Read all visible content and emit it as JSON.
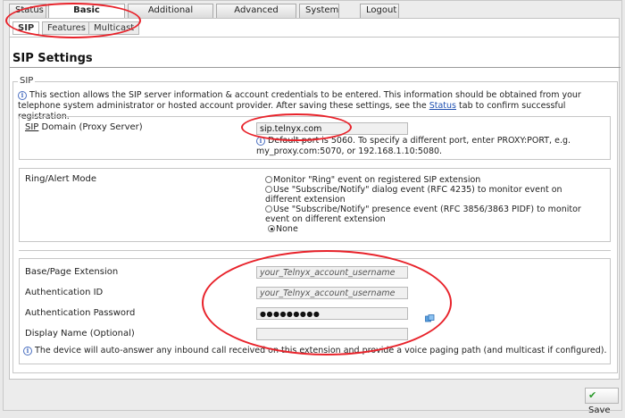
{
  "top_tabs": [
    "Status",
    "Basic Settings",
    "Additional Features",
    "Advanced Settings",
    "System",
    "Logout"
  ],
  "sub_tabs": [
    "SIP",
    "Features",
    "Multicast"
  ],
  "page_title": "SIP Settings",
  "legend": "SIP",
  "intro": {
    "text_before_link": "This section allows the SIP server information & account credentials to be entered. This information should be obtained from your telephone system administrator or hosted account provider. After saving these settings, see the ",
    "link": "Status",
    "text_after_link": " tab to confirm successful registration."
  },
  "sip_domain": {
    "label_abbr": "SIP",
    "label_rest": " Domain (Proxy Server)",
    "value": "sip.telnyx.com",
    "hint": "Default port is 5060. To specify a different port, enter PROXY:PORT, e.g. my_proxy.com:5070, or 192.168.1.10:5080."
  },
  "ring_mode": {
    "label": "Ring/Alert Mode",
    "options": [
      "Monitor \"Ring\" event on registered SIP extension",
      "Use \"Subscribe/Notify\" dialog event (RFC 4235) to monitor event on different extension",
      "Use \"Subscribe/Notify\" presence event (RFC 3856/3863 PIDF) to monitor event on different extension",
      "None"
    ],
    "selected_index": 3
  },
  "account": {
    "base_label": "Base/Page Extension",
    "base_value": "your_Telnyx_account_username",
    "auth_id_label": "Authentication ID",
    "auth_id_value": "your_Telnyx_account_username",
    "password_label": "Authentication Password",
    "password_value": "●●●●●●●●●",
    "display_label": "Display Name (Optional)",
    "display_value": "",
    "note": "The device will auto-answer any inbound call received on this extension and provide a voice paging path (and multicast if configured)."
  },
  "save_label": "Save",
  "colors": {
    "annotation": "#e8222a",
    "link": "#1e4fb0",
    "save_check": "#2a9a2a"
  },
  "icons": [
    "info-icon",
    "key-icon",
    "checkmark-icon"
  ]
}
